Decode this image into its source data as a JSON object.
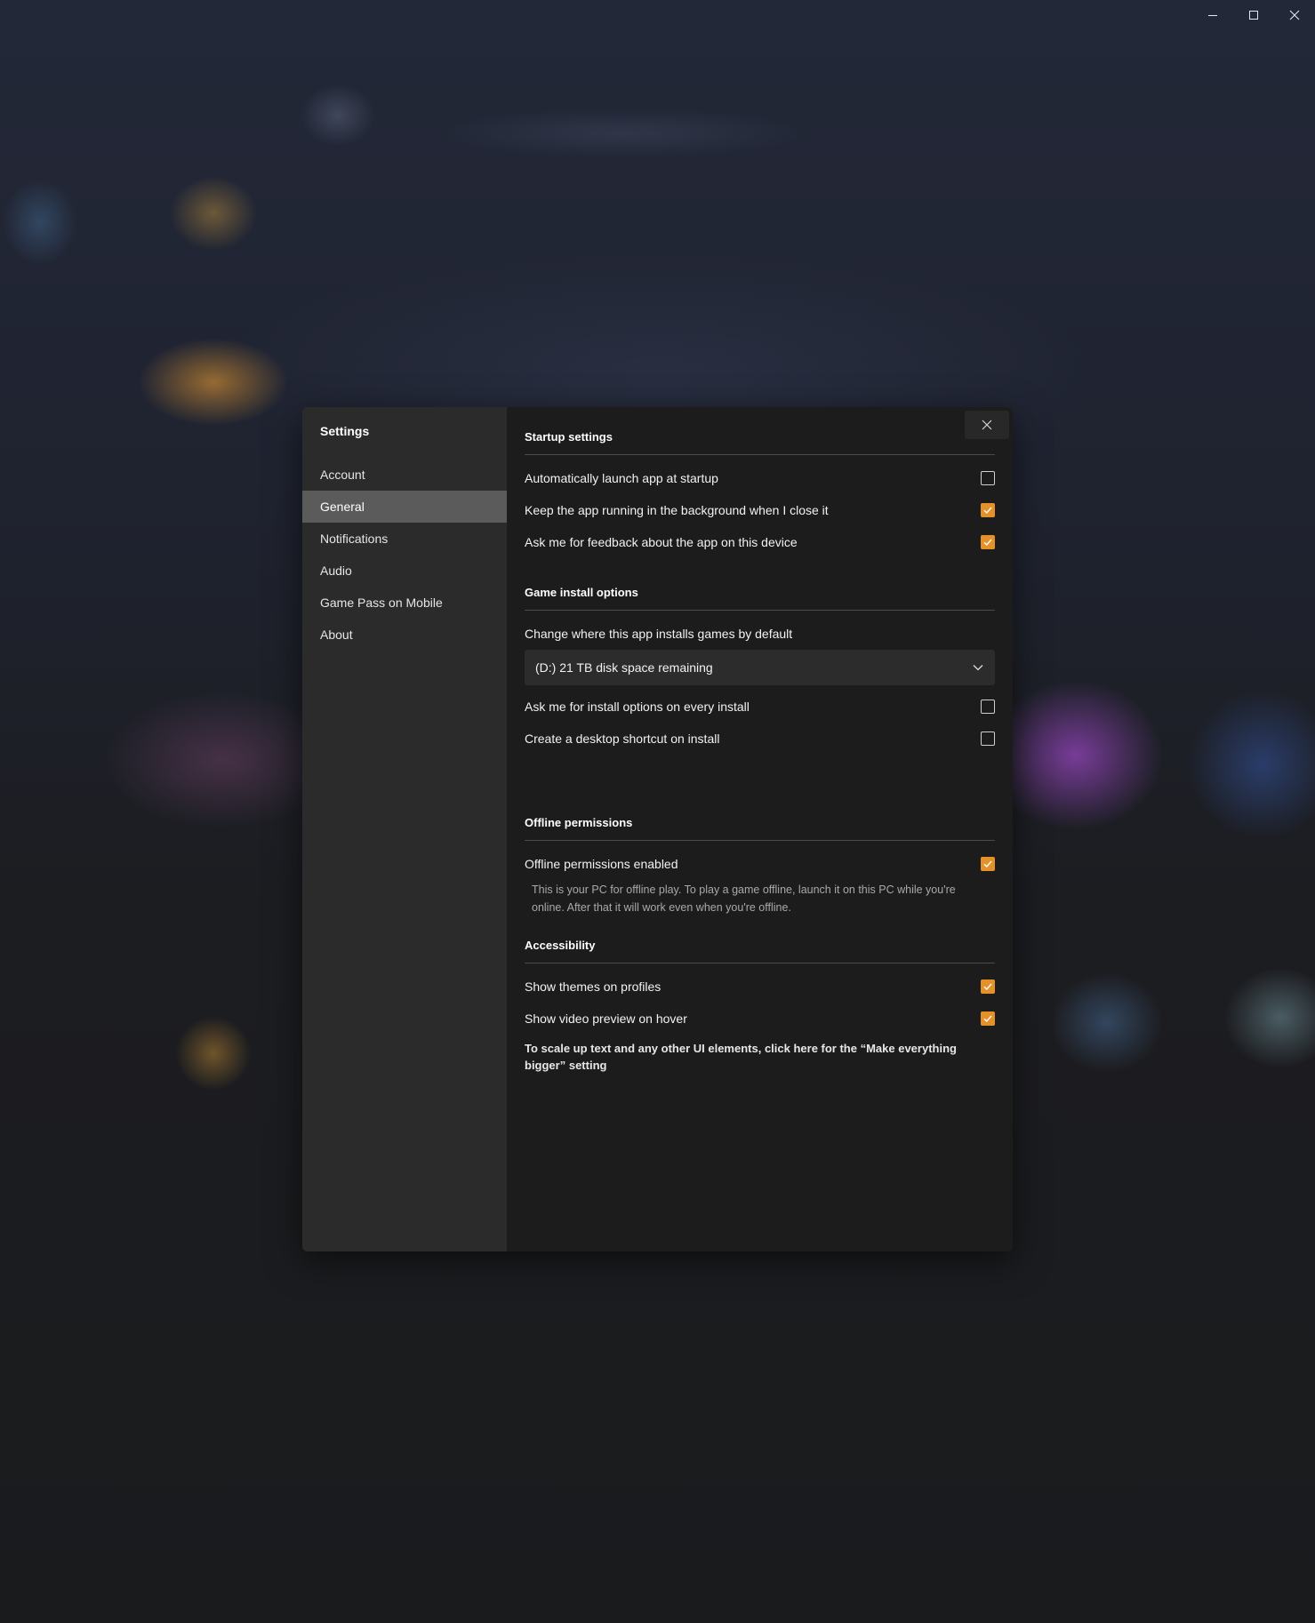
{
  "modal": {
    "title": "Settings",
    "nav": [
      "Account",
      "General",
      "Notifications",
      "Audio",
      "Game Pass on Mobile",
      "About"
    ],
    "active_nav": "General"
  },
  "startup": {
    "title": "Startup settings",
    "auto_launch": "Automatically launch app at startup",
    "keep_running": "Keep the app running in the background when I close it",
    "feedback": "Ask me for feedback about the app on this device"
  },
  "install": {
    "title": "Game install options",
    "location_label": "Change where this app installs games by default",
    "location_value": "(D:) 21 TB disk space remaining",
    "ask_options": "Ask me for install options on every install",
    "desktop_shortcut": "Create a desktop shortcut on install"
  },
  "offline": {
    "title": "Offline permissions",
    "enabled": "Offline permissions enabled",
    "description": "This is your PC for offline play. To play a game offline, launch it on this PC while you're online. After that it will work even when you're offline."
  },
  "accessibility": {
    "title": "Accessibility",
    "themes": "Show themes on profiles",
    "video_preview": "Show video preview on hover",
    "scale_link": "To scale up text and any other UI elements, click here for the “Make everything bigger” setting"
  },
  "checkbox_states": {
    "auto_launch": false,
    "keep_running": true,
    "feedback": true,
    "ask_options": false,
    "desktop_shortcut": false,
    "offline_enabled": true,
    "themes": true,
    "video_preview": true
  },
  "colors": {
    "accent": "#e5912a",
    "sidebar_bg": "#2b2b2b",
    "content_bg": "#1c1c1c",
    "nav_active_bg": "#5b5b5b"
  },
  "icons": {
    "minimize": "minimize-icon",
    "maximize": "maximize-icon",
    "window_close": "close-icon",
    "modal_close": "close-icon",
    "dropdown": "chevron-down-icon",
    "checkmark": "checkmark-icon"
  }
}
